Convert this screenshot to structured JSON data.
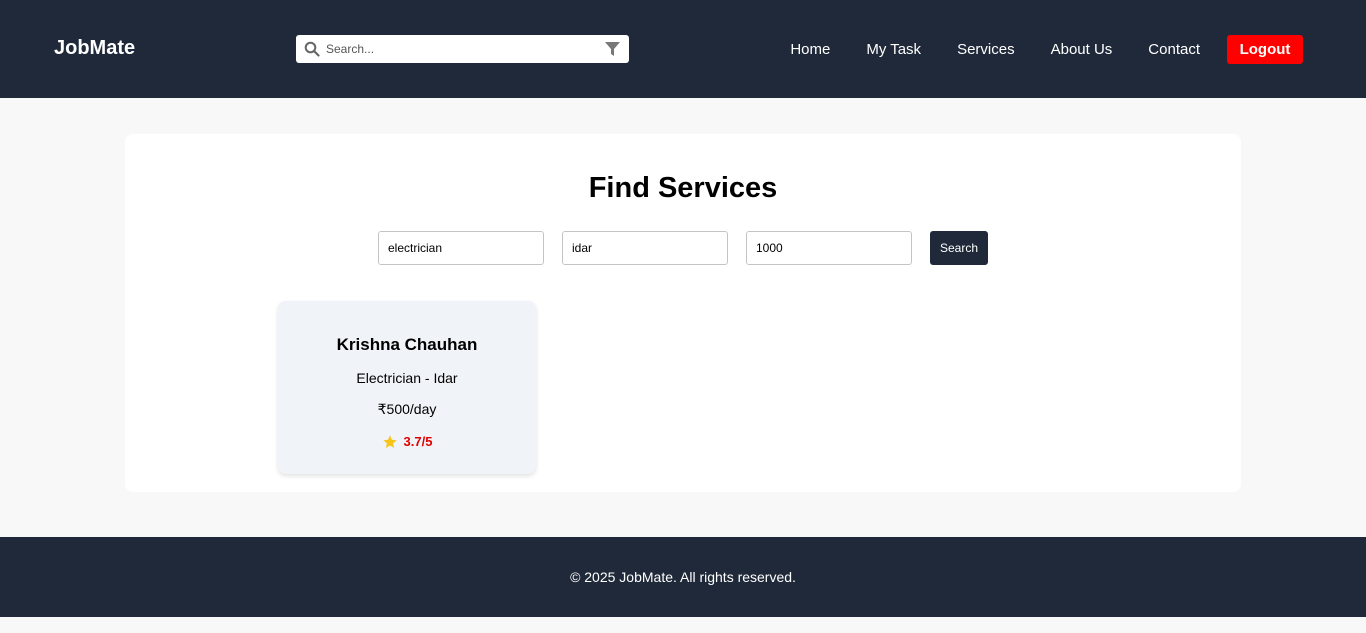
{
  "header": {
    "brand": "JobMate",
    "search": {
      "placeholder": "Search...",
      "value": ""
    },
    "nav": [
      "Home",
      "My Task",
      "Services",
      "About Us",
      "Contact"
    ],
    "logout_label": "Logout"
  },
  "main": {
    "title": "Find Services",
    "filters": {
      "service": "electrician",
      "location": "idar",
      "budget": "1000"
    },
    "search_label": "Search",
    "results": [
      {
        "name": "Krishna Chauhan",
        "role": "Electrician - Idar",
        "rate": "₹500/day",
        "rating": "3.7/5"
      }
    ]
  },
  "footer": {
    "text": "© 2025 JobMate. All rights reserved."
  },
  "colors": {
    "nav_bg": "#1f2939",
    "logout": "#ff0000",
    "rating": "#e00000",
    "star": "#f5c518",
    "card_bg": "#f0f3f8"
  },
  "icons": [
    "search-icon",
    "filter-icon",
    "star-icon"
  ]
}
